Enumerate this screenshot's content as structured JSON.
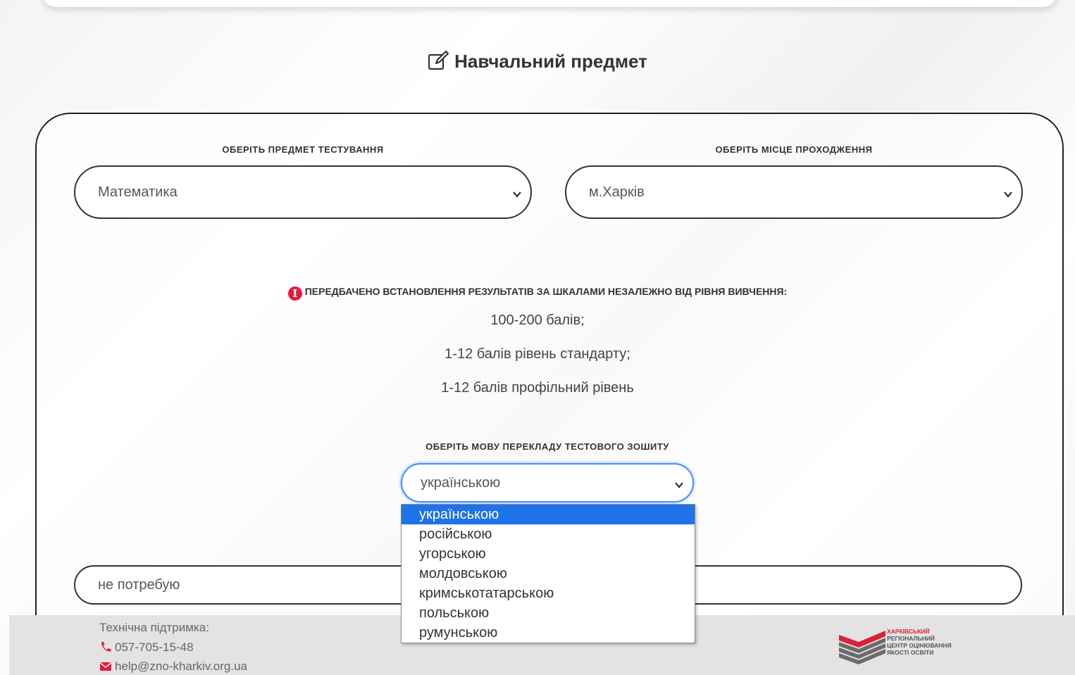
{
  "section": {
    "title": "Навчальний предмет",
    "icon": "edit-icon"
  },
  "subject": {
    "label": "ОБЕРІТЬ ПРЕДМЕТ ТЕСТУВАННЯ",
    "value": "Математика"
  },
  "location": {
    "label": "ОБЕРІТЬ МІСЦЕ ПРОХОДЖЕННЯ",
    "value": "м.Харків"
  },
  "info": {
    "icon": "info-icon",
    "text": "ПЕРЕДБАЧЕНО ВСТАНОВЛЕННЯ РЕЗУЛЬТАТІВ ЗА ШКАЛАМИ НЕЗАЛЕЖНО ВІД РІВНЯ ВИВЧЕННЯ:",
    "scales": [
      "100-200 балів;",
      "1-12 балів рівень стандарту;",
      "1-12 балів профільний рівень"
    ],
    "icon_color": "#e31b3b"
  },
  "language": {
    "label": "ОБЕРІТЬ МОВУ ПЕРЕКЛАДУ ТЕСТОВОГО ЗОШИТУ",
    "value": "українською",
    "options": [
      "українською",
      "російською",
      "угорською",
      "молдовською",
      "кримськотатарською",
      "польською",
      "румунською"
    ],
    "selected_index": 0,
    "highlight_color": "#1e73e8"
  },
  "accommodation": {
    "value": "не потребую"
  },
  "footer": {
    "support_label": "Технічна підтримка:",
    "phone": "057-705-15-48",
    "email": "help@zno-kharkiv.org.ua",
    "accent_color": "#e31b3b"
  },
  "logo": {
    "lines": [
      "ХАРКІВСЬКИЙ",
      "РЕГІОНАЛЬНИЙ",
      "ЦЕНТР ОЦІНЮВАННЯ",
      "ЯКОСТІ ОСВІТИ"
    ]
  }
}
